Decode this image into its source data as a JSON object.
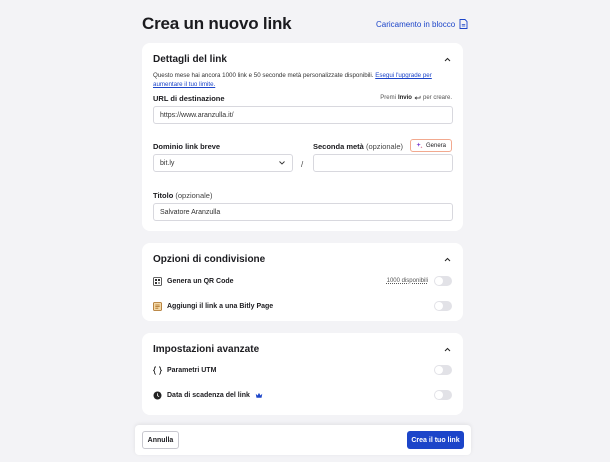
{
  "header": {
    "title": "Crea un nuovo link",
    "bulk_label": "Caricamento in blocco"
  },
  "details": {
    "title": "Dettagli del link",
    "description": "Questo mese hai ancora 1000 link e 50 seconde metà personalizzate disponibili.",
    "upgrade_link": "Esegui l'upgrade per aumentare il tuo limite.",
    "destination_label": "URL di destinazione",
    "hint_prefix": "Premi",
    "hint_key": "Invio",
    "hint_suffix": "per creare.",
    "destination_value": "https://www.aranzulla.it/",
    "domain_label": "Dominio link breve",
    "domain_value": "bit.ly",
    "second_half_label": "Seconda metà",
    "second_half_optional": "(opzionale)",
    "second_half_value": "",
    "generate_label": "Genera",
    "slash": "/",
    "title_label": "Titolo",
    "title_optional": "(opzionale)",
    "title_value": "Salvatore Aranzulla"
  },
  "sharing": {
    "title": "Opzioni di condivisione",
    "qr_label": "Genera un QR Code",
    "qr_badge": "1000 disponibili",
    "bitly_page_label": "Aggiungi il link a una Bitly Page"
  },
  "advanced": {
    "title": "Impostazioni avanzate",
    "utm_label": "Parametri UTM",
    "expiry_label": "Data di scadenza del link"
  },
  "footer": {
    "cancel_label": "Annulla",
    "create_label": "Crea il tuo link"
  },
  "colors": {
    "accent": "#1c45c9",
    "background": "#f3f3f6",
    "generate_border": "#f2a98f"
  }
}
